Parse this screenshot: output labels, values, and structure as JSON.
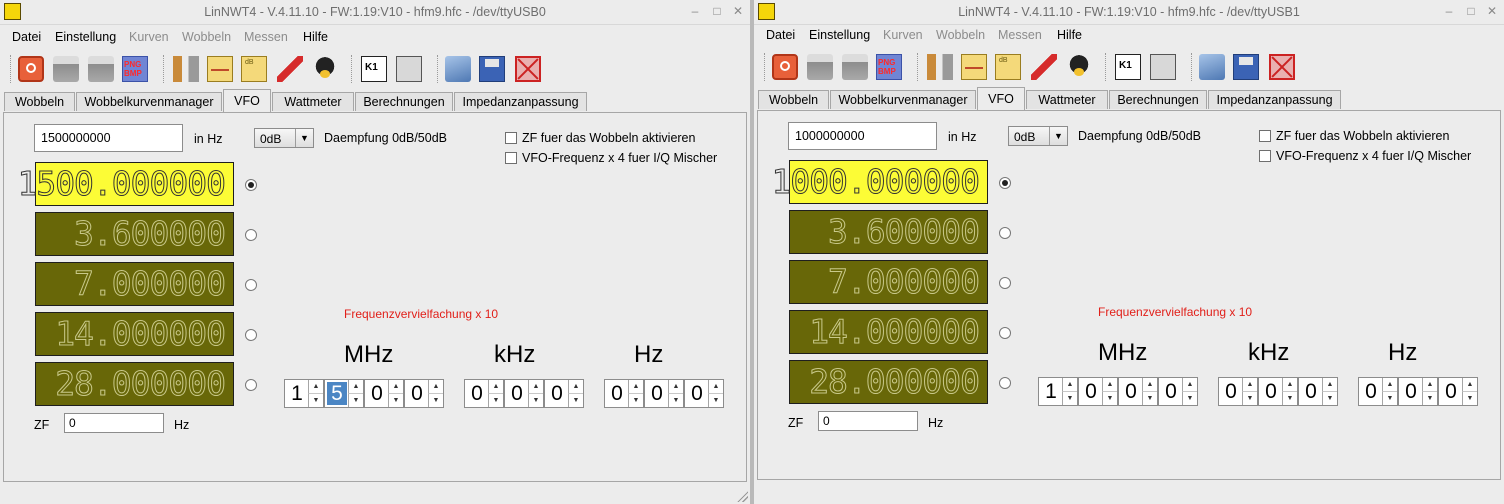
{
  "windows": [
    {
      "title": "LinNWT4 - V.4.11.10 - FW:1.19:V10 - hfm9.hfc - /dev/ttyUSB0",
      "menu": [
        {
          "label": "Datei",
          "enabled": true
        },
        {
          "label": "Einstellung",
          "enabled": true
        },
        {
          "label": "Kurven",
          "enabled": false
        },
        {
          "label": "Wobbeln",
          "enabled": false
        },
        {
          "label": "Messen",
          "enabled": false
        },
        {
          "label": "Hilfe",
          "enabled": true
        }
      ],
      "tabs": [
        {
          "label": "Wobbeln"
        },
        {
          "label": "Wobbelkurvenmanager"
        },
        {
          "label": "VFO",
          "active": true
        },
        {
          "label": "Wattmeter"
        },
        {
          "label": "Berechnungen"
        },
        {
          "label": "Impedanzanpassung"
        }
      ],
      "vfo": {
        "frequency_input": "1500000000",
        "freq_unit": "in Hz",
        "attenuation_value": "0dB",
        "attenuation_label": "Daempfung 0dB/50dB",
        "zf_checkbox_label": "ZF fuer das Wobbeln aktivieren",
        "vfo_x4_label": "VFO-Frequenz x 4 fuer I/Q Mischer",
        "lcds": [
          {
            "value": "1500.000000",
            "selected": true
          },
          {
            "value": "3.600000",
            "selected": false
          },
          {
            "value": "7.000000",
            "selected": false
          },
          {
            "value": "14.000000",
            "selected": false
          },
          {
            "value": "28.000000",
            "selected": false
          }
        ],
        "multiplier_label": "Frequenzvervielfachung x 10",
        "units": [
          "MHz",
          "kHz",
          "Hz"
        ],
        "mhz_digits": [
          "1",
          "5",
          "0",
          "0"
        ],
        "khz_digits": [
          "0",
          "0",
          "0"
        ],
        "hz_digits": [
          "0",
          "0",
          "0"
        ],
        "selected_digit": 1,
        "zf_label": "ZF",
        "zf_value": "0",
        "zf_unit": "Hz"
      }
    },
    {
      "title": "LinNWT4 - V.4.11.10 - FW:1.19:V10 - hfm9.hfc - /dev/ttyUSB1",
      "menu": [
        {
          "label": "Datei",
          "enabled": true
        },
        {
          "label": "Einstellung",
          "enabled": true
        },
        {
          "label": "Kurven",
          "enabled": false
        },
        {
          "label": "Wobbeln",
          "enabled": false
        },
        {
          "label": "Messen",
          "enabled": false
        },
        {
          "label": "Hilfe",
          "enabled": true
        }
      ],
      "tabs": [
        {
          "label": "Wobbeln"
        },
        {
          "label": "Wobbelkurvenmanager"
        },
        {
          "label": "VFO",
          "active": true
        },
        {
          "label": "Wattmeter"
        },
        {
          "label": "Berechnungen"
        },
        {
          "label": "Impedanzanpassung"
        }
      ],
      "vfo": {
        "frequency_input": "1000000000",
        "freq_unit": "in Hz",
        "attenuation_value": "0dB",
        "attenuation_label": "Daempfung 0dB/50dB",
        "zf_checkbox_label": "ZF fuer das Wobbeln aktivieren",
        "vfo_x4_label": "VFO-Frequenz x 4 fuer I/Q Mischer",
        "lcds": [
          {
            "value": "1000.000000",
            "selected": true
          },
          {
            "value": "3.600000",
            "selected": false
          },
          {
            "value": "7.000000",
            "selected": false
          },
          {
            "value": "14.000000",
            "selected": false
          },
          {
            "value": "28.000000",
            "selected": false
          }
        ],
        "multiplier_label": "Frequenzvervielfachung x 10",
        "units": [
          "MHz",
          "kHz",
          "Hz"
        ],
        "mhz_digits": [
          "1",
          "0",
          "0",
          "0"
        ],
        "khz_digits": [
          "0",
          "0",
          "0"
        ],
        "hz_digits": [
          "0",
          "0",
          "0"
        ],
        "selected_digit": -1,
        "zf_label": "ZF",
        "zf_value": "0",
        "zf_unit": "Hz"
      }
    }
  ]
}
